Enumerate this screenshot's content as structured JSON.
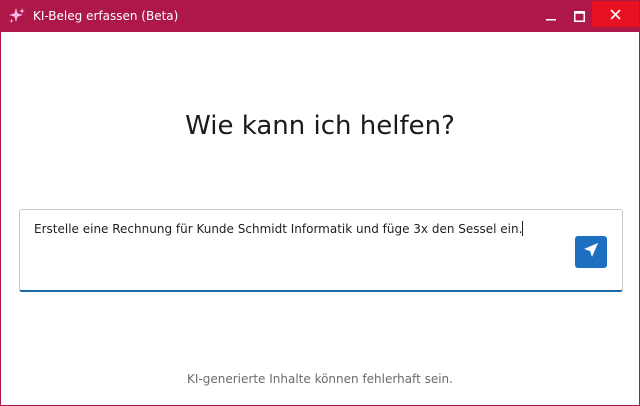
{
  "window": {
    "title": "KI-Beleg erfassen (Beta)",
    "app_icon": "sparkle-icon",
    "controls": {
      "minimize_icon": "minimize-icon",
      "maximize_icon": "maximize-icon",
      "close_icon": "close-icon"
    },
    "accent_color": "#ad1849",
    "close_hover_color": "#e81123"
  },
  "main": {
    "heading": "Wie kann ich helfen?",
    "prompt": {
      "value": "Erstelle eine Rechnung für Kunde Schmidt Informatik und füge 3x den Sessel ein.",
      "send_icon": "send-icon",
      "send_button_color": "#1d6fc2",
      "focus_color": "#1a6aa6"
    },
    "disclaimer": "KI-generierte Inhalte können fehlerhaft sein."
  }
}
